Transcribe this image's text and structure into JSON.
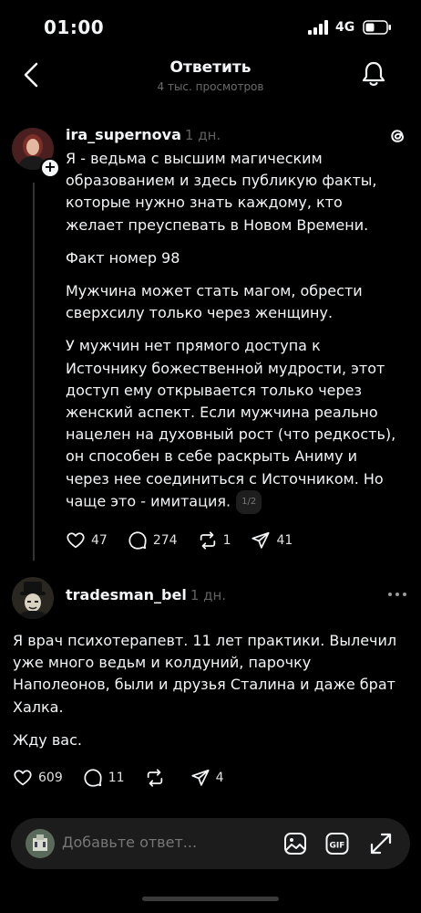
{
  "status_bar": {
    "time": "01:00",
    "network": "4G"
  },
  "header": {
    "title": "Ответить",
    "subtitle": "4 тыс. просмотров"
  },
  "post1": {
    "username": "ira_supernova",
    "time": "1 дн.",
    "paragraphs": [
      "Я - ведьма с высшим магическим образованием и здесь публикую факты, которые нужно знать каждому, кто желает преуспевать в Новом Времени.",
      "Факт номер 98",
      "Мужчина может стать магом, обрести сверхсилу только через женщину.",
      "У мужчин нет прямого доступа к Источнику божественной мудрости, этот доступ ему открывается только через женский аспект. Если мужчина реально нацелен на духовный рост (что редкость), он способен в себе раскрыть Аниму и через нее соединиться с Источником. Но чаще это - имитация."
    ],
    "page_indicator": "1/2",
    "likes": "47",
    "comments": "274",
    "reposts": "1",
    "shares": "41"
  },
  "post2": {
    "username": "tradesman_bel",
    "time": "1 дн.",
    "paragraphs": [
      "Я врач психотерапевт. 11 лет практики.  Вылечил уже много ведьм и колдуний, парочку Наполеонов, были и друзья Сталина и даже брат Халка.",
      "Жду вас."
    ],
    "likes": "609",
    "comments": "11",
    "reposts": "",
    "shares": "4"
  },
  "compose": {
    "placeholder": "Добавьте ответ..."
  },
  "colors": {
    "background": "#000000",
    "text": "#f3f5f7",
    "muted": "#616161"
  }
}
